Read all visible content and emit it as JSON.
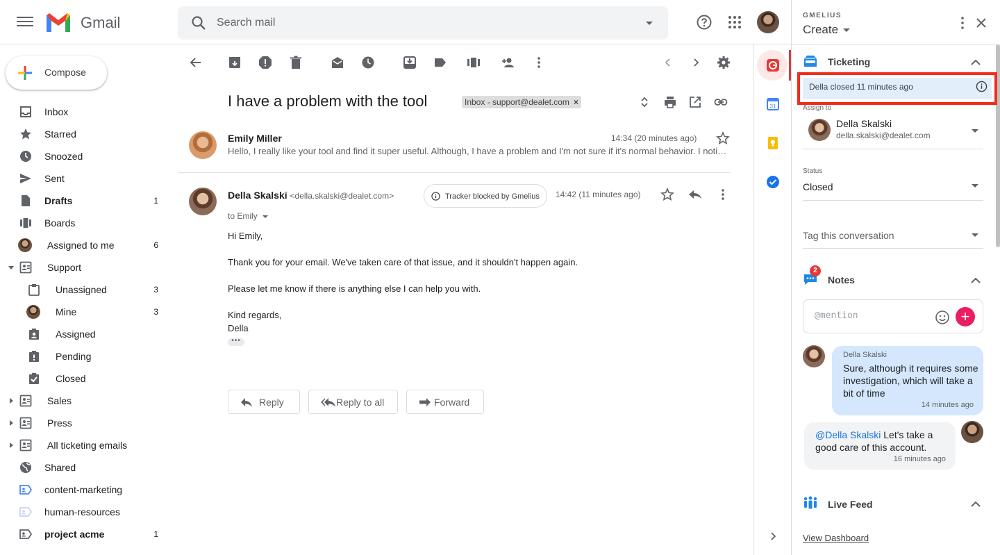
{
  "header": {
    "app_name": "Gmail",
    "search_placeholder": "Search mail"
  },
  "nav": {
    "compose_label": "Compose",
    "items": [
      {
        "label": "Inbox",
        "count": "",
        "bold": false
      },
      {
        "label": "Starred",
        "count": "",
        "bold": false
      },
      {
        "label": "Snoozed",
        "count": "",
        "bold": false
      },
      {
        "label": "Sent",
        "count": "",
        "bold": false
      },
      {
        "label": "Drafts",
        "count": "1",
        "bold": true
      },
      {
        "label": "Boards",
        "count": "",
        "bold": false
      },
      {
        "label": "Assigned to me",
        "count": "6",
        "bold": false
      },
      {
        "label": "Support",
        "count": "",
        "bold": false
      },
      {
        "label": "Unassigned",
        "count": "3",
        "bold": false
      },
      {
        "label": "Mine",
        "count": "3",
        "bold": false
      },
      {
        "label": "Assigned",
        "count": "",
        "bold": false
      },
      {
        "label": "Pending",
        "count": "",
        "bold": false
      },
      {
        "label": "Closed",
        "count": "",
        "bold": false
      },
      {
        "label": "Sales",
        "count": "",
        "bold": false
      },
      {
        "label": "Press",
        "count": "",
        "bold": false
      },
      {
        "label": "All ticketing emails",
        "count": "",
        "bold": false
      },
      {
        "label": "Shared",
        "count": "",
        "bold": false
      },
      {
        "label": "content-marketing",
        "count": "",
        "bold": false
      },
      {
        "label": "human-resources",
        "count": "",
        "bold": false
      },
      {
        "label": "project acme",
        "count": "1",
        "bold": true
      }
    ]
  },
  "thread": {
    "subject": "I have a problem with the tool",
    "label_chip": "Inbox - support@dealet.com",
    "chip_remove": "×",
    "messages": [
      {
        "sender": "Emily Miller",
        "time": "14:34 (20 minutes ago)",
        "snippet": "Hello, I really like your tool and find it super useful. Although, I have a problem and I'm not sure if it's normal behavior. I noticed that when I try to do that, it doesn't work as expected."
      },
      {
        "sender": "Della Skalski",
        "sender_email": "<della.skalski@dealet.com>",
        "tracker": "Tracker blocked by Gmelius",
        "time": "14:42 (11 minutes ago)",
        "to": "to Emily",
        "body": [
          "Hi Emily,",
          "Thank you for your email. We've taken care of that issue, and it shouldn't happen again.",
          "Please let me know if there is anything else I can help you with.",
          "Kind regards,",
          "Della"
        ],
        "ellipsis": "•••"
      }
    ],
    "actions": {
      "reply": "Reply",
      "reply_all": "Reply to all",
      "forward": "Forward"
    }
  },
  "panel": {
    "brand": "GMELIUS",
    "title": "Create",
    "ticketing": {
      "title": "Ticketing",
      "status_message": "Della closed 11 minutes ago",
      "assign_label": "Assign to",
      "assignee_name": "Della Skalski",
      "assignee_email": "della.skalski@dealet.com",
      "status_label": "Status",
      "status_value": "Closed",
      "tag_placeholder": "Tag this conversation"
    },
    "notes": {
      "title": "Notes",
      "badge": "2",
      "input_placeholder": "@mention",
      "add_label": "+",
      "items": [
        {
          "author": "Della Skalski",
          "text": "Sure, although it requires some investigation, which will take a bit of time",
          "time": "14 minutes ago"
        },
        {
          "mention": "@Della Skalski",
          "text": " Let's take a good care of this account.",
          "time": "16 minutes ago"
        }
      ]
    },
    "live_feed": {
      "title": "Live Feed",
      "dashboard_link": "View Dashboard"
    }
  },
  "colors": {
    "highlight_border": "#f22c1a",
    "status_bg": "#e3eefb",
    "add_button": "#e91e63",
    "note_bubble": "#d4e7fd"
  }
}
